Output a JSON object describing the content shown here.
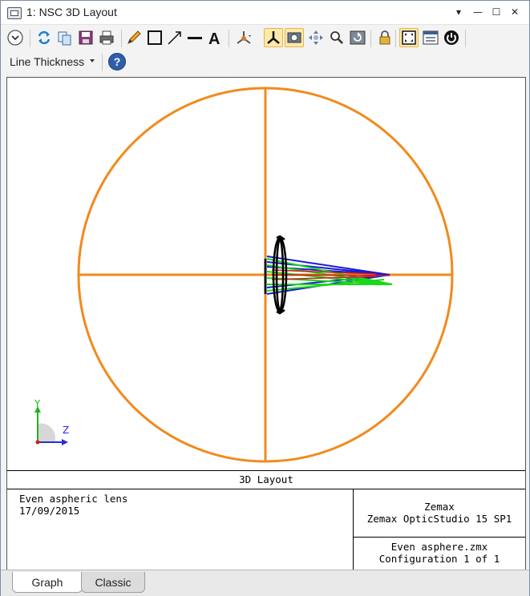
{
  "window": {
    "title": "1: NSC 3D Layout"
  },
  "window_controls": {
    "menu": "▾",
    "minimize": "—",
    "maximize": "☐",
    "close": "✕"
  },
  "toolbar": {
    "line_thickness_label": "Line Thickness",
    "help_label": "?",
    "icons": [
      "expand-icon",
      "refresh-icon",
      "copy-icon",
      "save-icon",
      "print-icon",
      "pencil-icon",
      "rectangle-icon",
      "arrow-icon",
      "line-icon",
      "text-icon",
      "rotate-icon",
      "axes-icon",
      "camera-icon",
      "pan-icon",
      "zoom-icon",
      "reset-view-icon",
      "lock-icon",
      "fit-icon",
      "window-icon",
      "power-icon"
    ]
  },
  "graph": {
    "caption": "3D Layout",
    "description": "Even aspheric lens",
    "date": "17/09/2015",
    "company": "Zemax",
    "software": "Zemax OpticStudio 15 SP1",
    "file": "Even asphere.zmx",
    "configuration": "Configuration 1 of 1",
    "axis_y": "Y",
    "axis_z": "Z",
    "colors": {
      "detector": "#f28a1c",
      "lens": "#000000",
      "ray_blue": "#1a1ad6",
      "ray_green": "#19d919",
      "ray_red": "#d51a1a"
    }
  },
  "tabs": [
    {
      "label": "Graph",
      "selected": true
    },
    {
      "label": "Classic",
      "selected": false
    }
  ]
}
